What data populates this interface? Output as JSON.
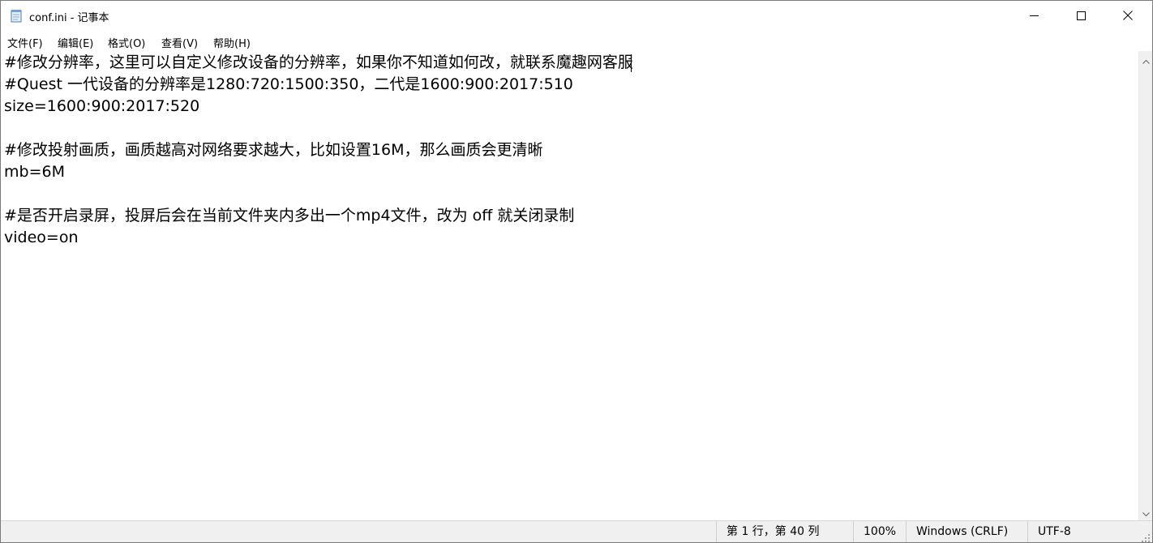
{
  "window": {
    "title": "conf.ini - 记事本",
    "icon": "notepad-icon"
  },
  "controls": {
    "minimize_icon": "minimize-icon",
    "maximize_icon": "maximize-icon",
    "close_icon": "close-icon"
  },
  "menu": {
    "items": [
      {
        "label": "文件(F)"
      },
      {
        "label": "编辑(E)"
      },
      {
        "label": "格式(O)"
      },
      {
        "label": "查看(V)"
      },
      {
        "label": "帮助(H)"
      }
    ]
  },
  "editor": {
    "lines": [
      "#修改分辨率，这里可以自定义修改设备的分辨率，如果你不知道如何改，就联系魔趣网客服",
      "#Quest 一代设备的分辨率是1280:720:1500:350，二代是1600:900:2017:510",
      "size=1600:900:2017:520",
      "",
      "#修改投射画质，画质越高对网络要求越大，比如设置16M，那么画质会更清晰",
      "mb=6M",
      "",
      "#是否开启录屏，投屏后会在当前文件夹内多出一个mp4文件，改为 off 就关闭录制",
      "video=on"
    ]
  },
  "status": {
    "position": "第 1 行，第 40 列",
    "zoom": "100%",
    "line_ending": "Windows (CRLF)",
    "encoding": "UTF-8"
  }
}
